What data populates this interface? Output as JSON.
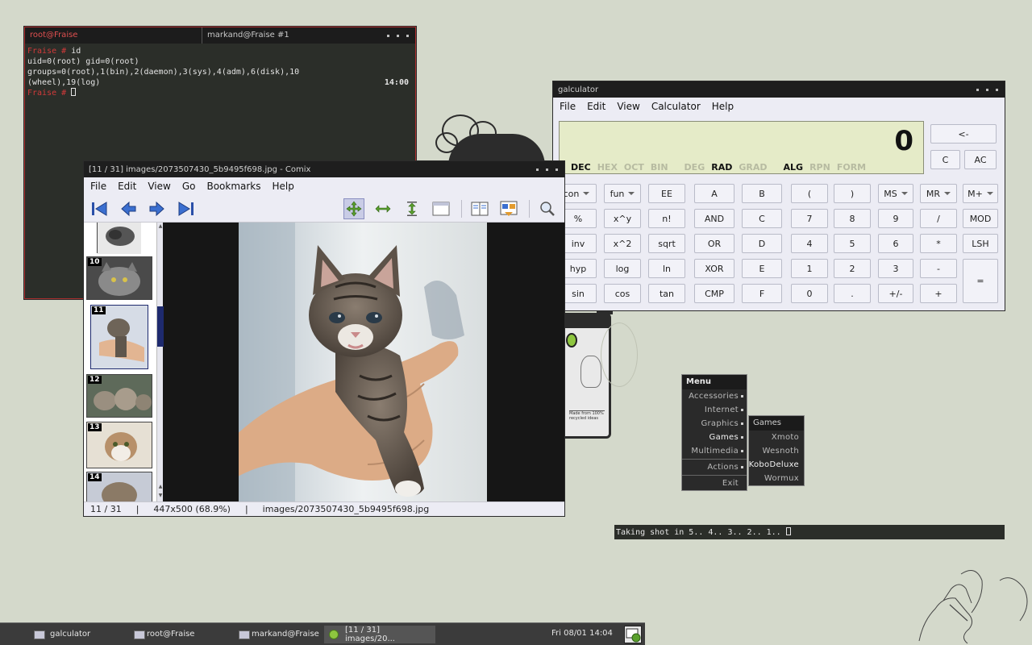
{
  "terminal": {
    "tab_active": "root@Fraise",
    "tab_other": "markand@Fraise #1",
    "line1_prompt": "Fraise # ",
    "line1_cmd": "id",
    "line2": "uid=0(root) gid=0(root) groups=0(root),1(bin),2(daemon),3(sys),4(adm),6(disk),10",
    "line3": "(wheel),19(log)",
    "line4_prompt": "Fraise # ",
    "clock": "14:00"
  },
  "comix": {
    "title": "[11 / 31]  images/2073507430_5b9495f698.jpg - Comix",
    "menu": [
      "File",
      "Edit",
      "View",
      "Go",
      "Bookmarks",
      "Help"
    ],
    "thumb_numbers": [
      "10",
      "11",
      "12",
      "13",
      "14"
    ],
    "status": {
      "page": "11 / 31",
      "sep1": "|",
      "size": "447x500 (68.9%)",
      "sep2": "|",
      "file": "images/2073507430_5b9495f698.jpg"
    }
  },
  "calculator": {
    "title": "galculator",
    "menu": [
      "File",
      "Edit",
      "View",
      "Calculator",
      "Help"
    ],
    "display_value": "0",
    "modes": {
      "dec": "DEC",
      "hex": "HEX",
      "oct": "OCT",
      "bin": "BIN",
      "deg": "DEG",
      "rad": "RAD",
      "grad": "GRAD",
      "alg": "ALG",
      "rpn": "RPN",
      "form": "FORM"
    },
    "top_buttons": {
      "backspace": "<-",
      "clear": "C",
      "all_clear": "AC"
    },
    "rows": [
      [
        "con",
        "fun",
        "EE",
        "A",
        "B",
        "(",
        ")",
        "MS",
        "MR",
        "M+"
      ],
      [
        "%",
        "x^y",
        "n!",
        "AND",
        "C",
        "7",
        "8",
        "9",
        "/",
        "MOD"
      ],
      [
        "inv",
        "x^2",
        "sqrt",
        "OR",
        "D",
        "4",
        "5",
        "6",
        "*",
        "LSH"
      ],
      [
        "hyp",
        "log",
        "ln",
        "XOR",
        "E",
        "1",
        "2",
        "3",
        "-",
        "="
      ],
      [
        "sin",
        "cos",
        "tan",
        "CMP",
        "F",
        "0",
        ".",
        "+/-",
        "+"
      ]
    ]
  },
  "menu": {
    "header": "Menu",
    "items": [
      "Accessories",
      "Internet",
      "Graphics",
      "Games",
      "Multimedia",
      "Actions",
      "Exit"
    ],
    "submenu_header": "Games",
    "submenu_items": [
      "Xmoto",
      "Wesnoth",
      "KoboDeluxe",
      "Wormux"
    ]
  },
  "scrot": {
    "text": "Taking shot in 5.. 4.. 3.. 2.. 1.. "
  },
  "taskbar": {
    "tasks": [
      "galculator",
      "root@Fraise",
      "markand@Fraise",
      "[11 / 31]  images/20..."
    ],
    "clock": "Fri 08/01 14:04"
  },
  "colors": {
    "desktop_bg": "#d4d9cb",
    "terminal_bg": "#2b2e29",
    "prompt_red": "#d23a3a",
    "calc_display": "#e5ebc8",
    "accent_navy": "#1e2a6e"
  }
}
